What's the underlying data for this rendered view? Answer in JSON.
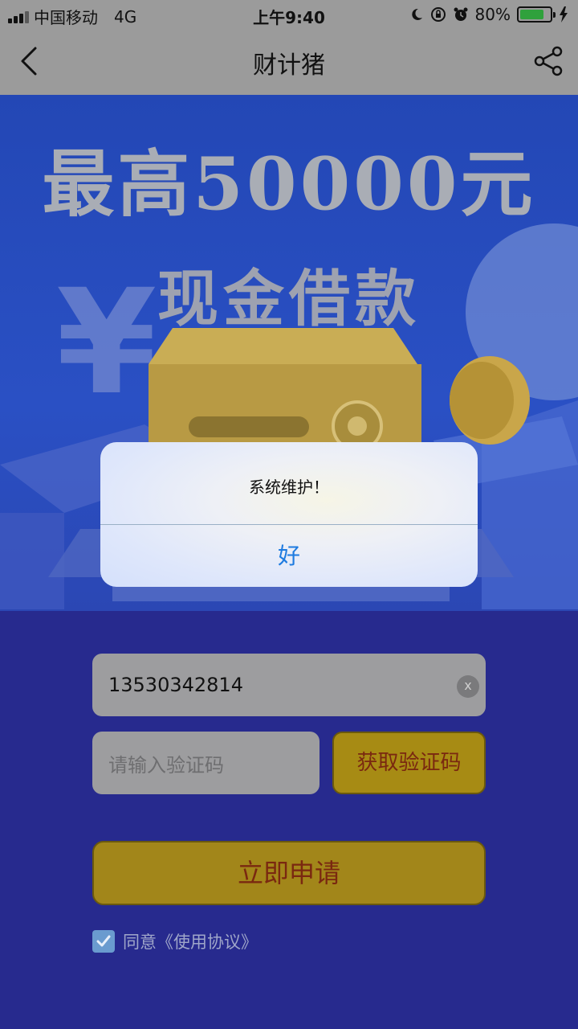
{
  "status_bar": {
    "carrier": "中国移动",
    "network": "4G",
    "time": "上午9:40",
    "battery_percent": "80%",
    "battery_level": 0.8,
    "icons": [
      "moon-icon",
      "rotation-lock-icon",
      "alarm-icon",
      "charging-bolt-icon"
    ]
  },
  "nav": {
    "title": "财计猪",
    "back_icon": "chevron-left-icon",
    "share_icon": "share-icon"
  },
  "hero": {
    "title": "最高50000元",
    "subtitle": "现金借款"
  },
  "form": {
    "phone_value": "13530342814",
    "clear_label": "x",
    "code_placeholder": "请输入验证码",
    "get_code_label": "获取验证码",
    "apply_label": "立即申请",
    "agree_checked": true,
    "agree_text": "同意《使用协议》"
  },
  "alert": {
    "message": "系统维护！",
    "button_label": "好"
  },
  "colors": {
    "nav_bg": "#9b9b9b",
    "hero_bg": "#2a50c4",
    "form_bg": "#272a8e",
    "accent_button": "#a2861a",
    "alert_button_text": "#1e7be0"
  }
}
